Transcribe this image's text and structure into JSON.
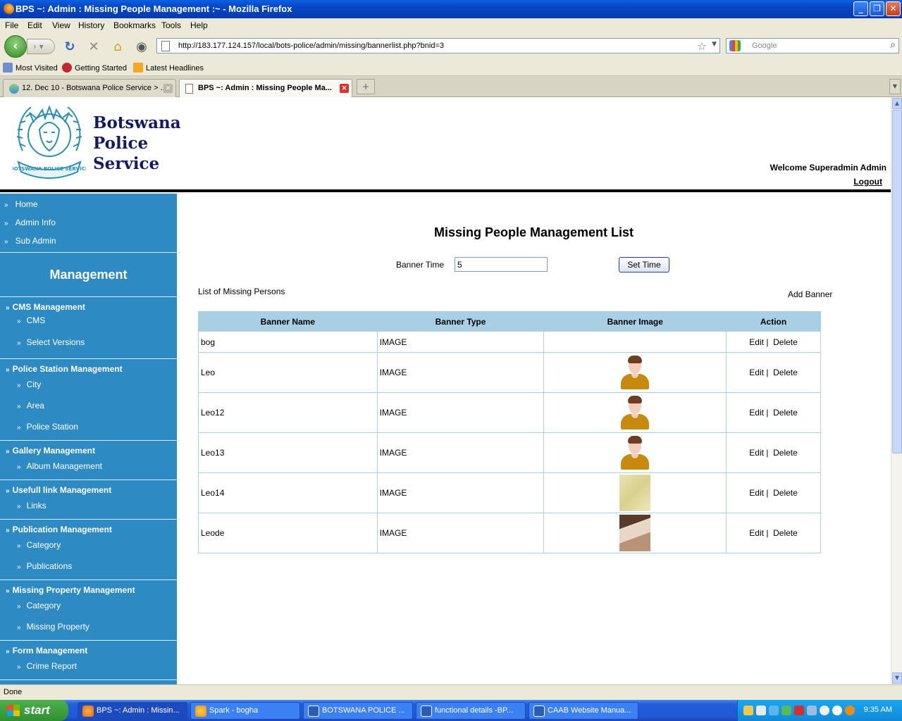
{
  "window": {
    "title": "BPS ~: Admin : Missing People Management :~ - Mozilla Firefox"
  },
  "menu": [
    "File",
    "Edit",
    "View",
    "History",
    "Bookmarks",
    "Tools",
    "Help"
  ],
  "address": {
    "url": "http://183.177.124.157/local/bots-police/admin/missing/bannerlist.php?bnid=3"
  },
  "search": {
    "placeholder": "Google"
  },
  "bookmarks": [
    "Most Visited",
    "Getting Started",
    "Latest Headlines"
  ],
  "tabs": [
    {
      "label": "12. Dec 10 - Botswana Police Service > ..."
    },
    {
      "label": "BPS ~: Admin : Missing People Ma..."
    }
  ],
  "header": {
    "brand": [
      "Botswana",
      "Police",
      "Service"
    ],
    "welcome": "Welcome Superadmin Admin",
    "logout": "Logout"
  },
  "sidebar": {
    "top_items": [
      "Home",
      "Admin Info",
      "Sub Admin"
    ],
    "heading": "Management",
    "groups": [
      {
        "title": "CMS Management",
        "items": [
          "CMS",
          "Select Versions"
        ]
      },
      {
        "title": "Police Station Management",
        "items": [
          "City",
          "Area",
          "Police Station"
        ]
      },
      {
        "title": "Gallery Management",
        "items": [
          "Album Management"
        ]
      },
      {
        "title": "Usefull link Management",
        "items": [
          "Links"
        ]
      },
      {
        "title": "Publication Management",
        "items": [
          "Category",
          "Publications"
        ]
      },
      {
        "title": "Missing Property Management",
        "items": [
          "Category",
          "Missing Property"
        ]
      },
      {
        "title": "Form Management",
        "items": [
          "Crime Report"
        ]
      }
    ]
  },
  "main": {
    "title": "Missing People Management List",
    "banner_time_label": "Banner Time",
    "banner_time_value": "5",
    "set_time_button": "Set Time",
    "list_label": "List of Missing Persons",
    "add_banner": "Add Banner",
    "table": {
      "headers": [
        "Banner Name",
        "Banner Type",
        "Banner Image",
        "Action"
      ],
      "rows": [
        {
          "name": "bog",
          "type": "IMAGE",
          "image": "none"
        },
        {
          "name": "Leo",
          "type": "IMAGE",
          "image": "person-avatar"
        },
        {
          "name": "Leo12",
          "type": "IMAGE",
          "image": "person-avatar"
        },
        {
          "name": "Leo13",
          "type": "IMAGE",
          "image": "person-avatar"
        },
        {
          "name": "Leo14",
          "type": "IMAGE",
          "image": "hand-photo"
        },
        {
          "name": "Leode",
          "type": "IMAGE",
          "image": "bed-photo"
        }
      ],
      "edit_label": "Edit",
      "separator": "|",
      "delete_label": "Delete"
    }
  },
  "status": {
    "text": "Done"
  },
  "taskbar": {
    "start": "start",
    "tasks": [
      "BPS ~: Admin : Missin...",
      "Spark - bogha",
      "BOTSWANA POLICE ...",
      "functional details -BP...",
      "CAAB Website Manua..."
    ],
    "clock": "9:35 AM"
  }
}
